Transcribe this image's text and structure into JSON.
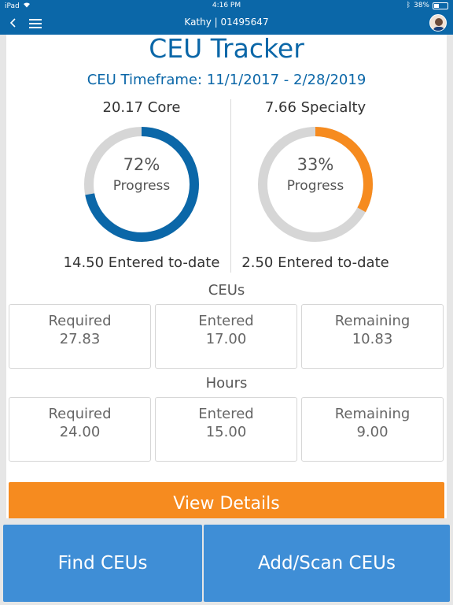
{
  "status": {
    "device": "iPad",
    "time": "4:16 PM",
    "battery": "38%"
  },
  "nav": {
    "title": "Kathy | 01495647"
  },
  "header": {
    "title": "CEU Tracker",
    "timeframe": "CEU Timeframe: 11/1/2017 - 2/28/2019"
  },
  "core": {
    "caption": "20.17 Core",
    "percent_text": "72%",
    "progress_label": "Progress",
    "progress": 0.72,
    "color": "#0b67a8",
    "footer": "14.50 Entered to-date"
  },
  "specialty": {
    "caption": "7.66 Specialty",
    "percent_text": "33%",
    "progress_label": "Progress",
    "progress": 0.33,
    "color": "#f68b1f",
    "footer": "2.50 Entered to-date"
  },
  "ceus": {
    "title": "CEUs",
    "items": [
      {
        "label": "Required",
        "value": "27.83"
      },
      {
        "label": "Entered",
        "value": "17.00"
      },
      {
        "label": "Remaining",
        "value": "10.83"
      }
    ]
  },
  "hours": {
    "title": "Hours",
    "items": [
      {
        "label": "Required",
        "value": "24.00"
      },
      {
        "label": "Entered",
        "value": "15.00"
      },
      {
        "label": "Remaining",
        "value": "9.00"
      }
    ]
  },
  "buttons": {
    "view_details": "View Details",
    "find": "Find CEUs",
    "add_scan": "Add/Scan CEUs"
  },
  "colors": {
    "brand": "#0b67a8",
    "accent": "#f68b1f",
    "button": "#3f8ed6",
    "track": "#d6d6d6"
  }
}
